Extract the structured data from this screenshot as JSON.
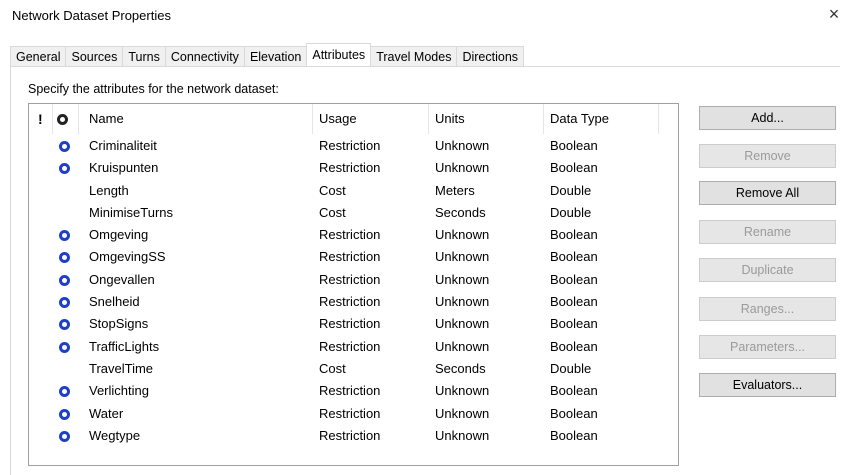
{
  "window": {
    "title": "Network Dataset Properties",
    "close_glyph": "×"
  },
  "tabs": [
    {
      "label": "General",
      "active": false
    },
    {
      "label": "Sources",
      "active": false
    },
    {
      "label": "Turns",
      "active": false
    },
    {
      "label": "Connectivity",
      "active": false
    },
    {
      "label": "Elevation",
      "active": false
    },
    {
      "label": "Attributes",
      "active": true
    },
    {
      "label": "Travel Modes",
      "active": false
    },
    {
      "label": "Directions",
      "active": false
    }
  ],
  "instructions": "Specify the attributes for the network dataset:",
  "table": {
    "headers": {
      "exclamation": "!",
      "evaluator_icon": "evaluator-icon",
      "name": "Name",
      "usage": "Usage",
      "units": "Units",
      "data_type": "Data Type"
    },
    "rows": [
      {
        "evaluator": true,
        "name": "Criminaliteit",
        "usage": "Restriction",
        "units": "Unknown",
        "data_type": "Boolean"
      },
      {
        "evaluator": true,
        "name": "Kruispunten",
        "usage": "Restriction",
        "units": "Unknown",
        "data_type": "Boolean"
      },
      {
        "evaluator": false,
        "name": "Length",
        "usage": "Cost",
        "units": "Meters",
        "data_type": "Double"
      },
      {
        "evaluator": false,
        "name": "MinimiseTurns",
        "usage": "Cost",
        "units": "Seconds",
        "data_type": "Double"
      },
      {
        "evaluator": true,
        "name": "Omgeving",
        "usage": "Restriction",
        "units": "Unknown",
        "data_type": "Boolean"
      },
      {
        "evaluator": true,
        "name": "OmgevingSS",
        "usage": "Restriction",
        "units": "Unknown",
        "data_type": "Boolean"
      },
      {
        "evaluator": true,
        "name": "Ongevallen",
        "usage": "Restriction",
        "units": "Unknown",
        "data_type": "Boolean"
      },
      {
        "evaluator": true,
        "name": "Snelheid",
        "usage": "Restriction",
        "units": "Unknown",
        "data_type": "Boolean"
      },
      {
        "evaluator": true,
        "name": "StopSigns",
        "usage": "Restriction",
        "units": "Unknown",
        "data_type": "Boolean"
      },
      {
        "evaluator": true,
        "name": "TrafficLights",
        "usage": "Restriction",
        "units": "Unknown",
        "data_type": "Boolean"
      },
      {
        "evaluator": false,
        "name": "TravelTime",
        "usage": "Cost",
        "units": "Seconds",
        "data_type": "Double"
      },
      {
        "evaluator": true,
        "name": "Verlichting",
        "usage": "Restriction",
        "units": "Unknown",
        "data_type": "Boolean"
      },
      {
        "evaluator": true,
        "name": "Water",
        "usage": "Restriction",
        "units": "Unknown",
        "data_type": "Boolean"
      },
      {
        "evaluator": true,
        "name": "Wegtype",
        "usage": "Restriction",
        "units": "Unknown",
        "data_type": "Boolean"
      }
    ]
  },
  "buttons": [
    {
      "label": "Add...",
      "enabled": true,
      "top": 0
    },
    {
      "label": "Remove",
      "enabled": false
    },
    {
      "label": "Remove All",
      "enabled": true
    },
    {
      "label": "Rename",
      "enabled": false
    },
    {
      "label": "Duplicate",
      "enabled": false
    },
    {
      "label": "Ranges...",
      "enabled": false
    },
    {
      "label": "Parameters...",
      "enabled": false
    },
    {
      "label": "Evaluators...",
      "enabled": true
    }
  ],
  "colors": {
    "evaluator_icon": "#1f3fc8",
    "disabled_text": "#9a9a9a"
  }
}
